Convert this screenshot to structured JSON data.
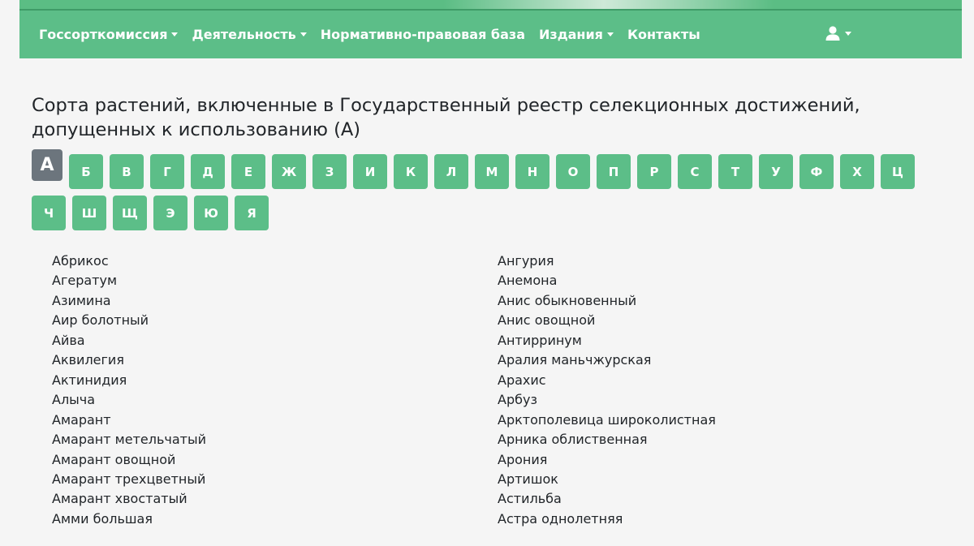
{
  "nav": {
    "items": [
      {
        "label": "Госсорткомиссия",
        "dropdown": true
      },
      {
        "label": "Деятельность",
        "dropdown": true
      },
      {
        "label": "Нормативно-правовая база",
        "dropdown": false
      },
      {
        "label": "Издания",
        "dropdown": true
      },
      {
        "label": "Контакты",
        "dropdown": false
      }
    ],
    "user_icon": "user-icon"
  },
  "page_title": "Сорта растений, включенные в Государственный реестр селекционных достижений, допущенных к использованию (А)",
  "alphabet": {
    "active": "А",
    "row1": [
      "Б",
      "В",
      "Г",
      "Д",
      "Е",
      "Ж",
      "З",
      "И",
      "К",
      "Л",
      "М",
      "Н",
      "О",
      "П",
      "Р",
      "С",
      "Т",
      "У",
      "Ф",
      "Х",
      "Ц"
    ],
    "row2": [
      "Ч",
      "Ш",
      "Щ",
      "Э",
      "Ю",
      "Я"
    ]
  },
  "list": {
    "left": [
      "Абрикос",
      "Агератум",
      "Азимина",
      "Аир болотный",
      "Айва",
      "Аквилегия",
      "Актинидия",
      "Алыча",
      "Амарант",
      "Амарант метельчатый",
      "Амарант овощной",
      "Амарант трехцветный",
      "Амарант хвостатый",
      "Амми большая"
    ],
    "right": [
      "Ангурия",
      "Анемона",
      "Анис обыкновенный",
      "Анис овощной",
      "Антирринум",
      "Аралия маньчжурская",
      "Арахис",
      "Арбуз",
      "Арктополевица широколистная",
      "Арника облиственная",
      "Арония",
      "Артишок",
      "Астильба",
      "Астра однолетняя"
    ]
  },
  "colors": {
    "navbar": "#5cbe88",
    "letter_button": "#5cbe88",
    "letter_active": "#6c757d",
    "background": "#f5f5f5"
  }
}
